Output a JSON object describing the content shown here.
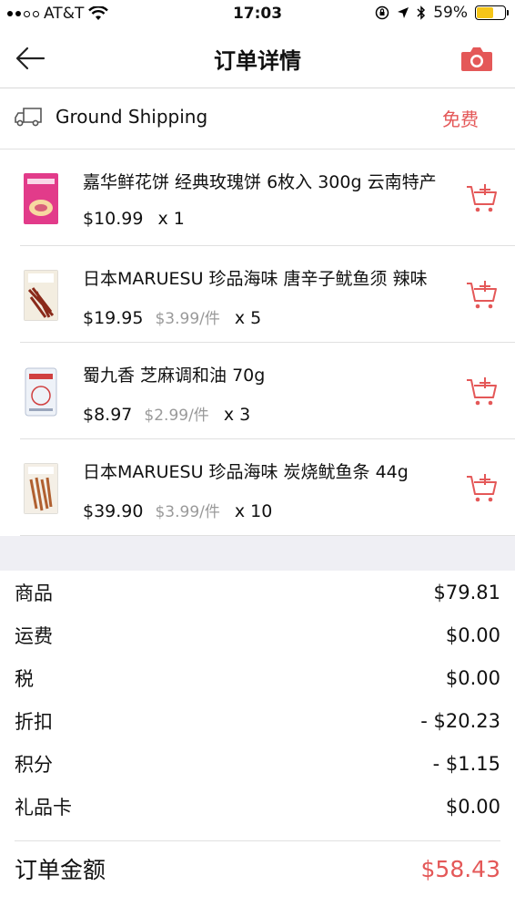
{
  "status_bar": {
    "carrier": "AT&T",
    "time": "17:03",
    "battery_percent": "59%",
    "battery_level": 0.59,
    "icons": [
      "signal-dots-icon",
      "wifi-icon",
      "rotation-lock-icon",
      "location-icon",
      "bluetooth-icon",
      "battery-icon"
    ]
  },
  "nav": {
    "title": "订单详情",
    "back_icon": "back-arrow-icon",
    "camera_icon": "camera-icon"
  },
  "shipping": {
    "method": "Ground Shipping",
    "fee": "免费"
  },
  "items": [
    {
      "name": "嘉华鲜花饼 经典玫瑰饼 6枚入 300g 云南特产",
      "price": "$10.99",
      "unit_price": "",
      "qty": "x 1"
    },
    {
      "name": "日本MARUESU 珍品海味 唐辛子鱿鱼须 辣味",
      "price": "$19.95",
      "unit_price": "$3.99/件",
      "qty": "x 5"
    },
    {
      "name": "蜀九香 芝麻调和油 70g",
      "price": "$8.97",
      "unit_price": "$2.99/件",
      "qty": "x 3"
    },
    {
      "name": "日本MARUESU 珍品海味 炭烧鱿鱼条 44g",
      "price": "$39.90",
      "unit_price": "$3.99/件",
      "qty": "x 10"
    }
  ],
  "summary": {
    "rows": [
      {
        "label": "商品",
        "value": "$79.81"
      },
      {
        "label": "运费",
        "value": "$0.00"
      },
      {
        "label": "税",
        "value": "$0.00"
      },
      {
        "label": "折扣",
        "value": "- $20.23"
      },
      {
        "label": "积分",
        "value": "- $1.15"
      },
      {
        "label": "礼品卡",
        "value": "$0.00"
      }
    ],
    "total_label": "订单金额",
    "total_value": "$58.43"
  },
  "colors": {
    "accent": "#e45858",
    "band": "#efeff4"
  }
}
